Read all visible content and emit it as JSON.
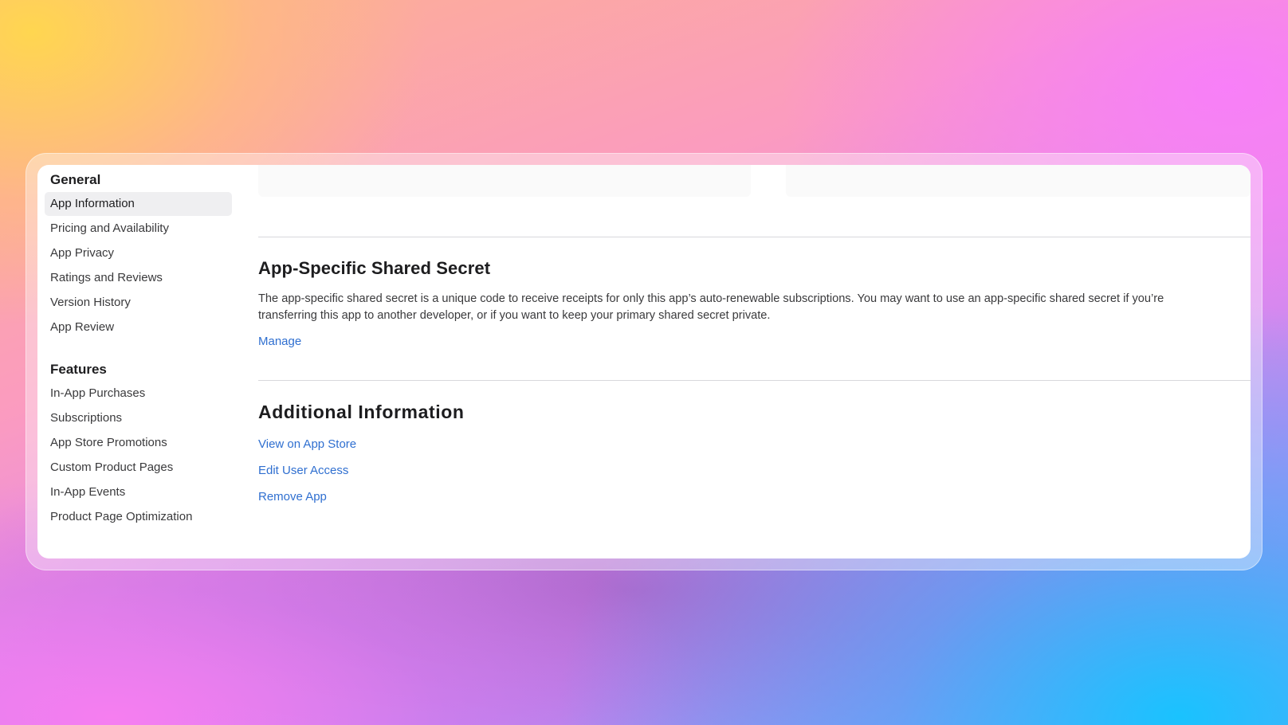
{
  "sidebar": {
    "general_heading": "General",
    "general_items": [
      {
        "label": "App Information",
        "active": true
      },
      {
        "label": "Pricing and Availability"
      },
      {
        "label": "App Privacy"
      },
      {
        "label": "Ratings and Reviews"
      },
      {
        "label": "Version History"
      },
      {
        "label": "App Review"
      }
    ],
    "features_heading": "Features",
    "features_items": [
      {
        "label": "In-App Purchases"
      },
      {
        "label": "Subscriptions"
      },
      {
        "label": "App Store Promotions"
      },
      {
        "label": "Custom Product Pages"
      },
      {
        "label": "In-App Events"
      },
      {
        "label": "Product Page Optimization"
      }
    ]
  },
  "main": {
    "shared_secret": {
      "title": "App-Specific Shared Secret",
      "description": "The app-specific shared secret is a unique code to receive receipts for only this app’s auto-renewable subscriptions. You may want to use an app-specific shared secret if you’re transferring this app to another developer, or if you want to keep your primary shared secret private.",
      "manage_label": "Manage"
    },
    "additional_info": {
      "title": "Additional Information",
      "links": [
        {
          "label": "View on App Store"
        },
        {
          "label": "Edit User Access"
        },
        {
          "label": "Remove App"
        }
      ]
    }
  },
  "colors": {
    "link": "#2f6fd0",
    "active_item_bg": "#efeff1",
    "divider": "#d8d8dc"
  }
}
